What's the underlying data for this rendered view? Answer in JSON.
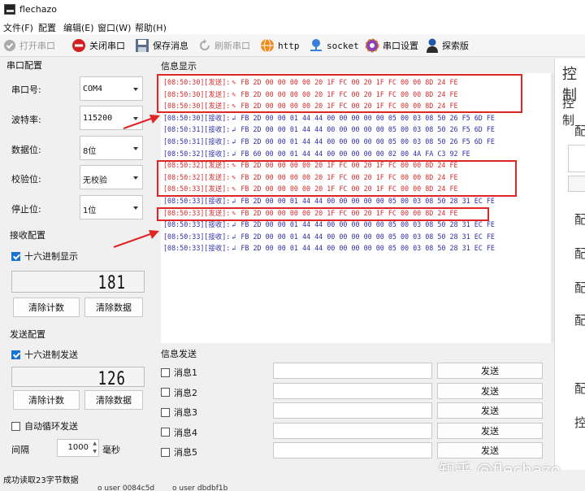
{
  "window": {
    "title": "flechazo"
  },
  "menu": [
    "文件(F)",
    "配置",
    "编辑(E)",
    "窗口(W)",
    "帮助(H)"
  ],
  "toolbar": {
    "open_port": "打开串口",
    "close_port": "关闭串口",
    "save_msg": "保存消息",
    "refresh_port": "刷新串口",
    "http": "http",
    "socket": "socket",
    "port_settings": "串口设置",
    "explore": "探索版"
  },
  "serial_config": {
    "title": "串口配置",
    "port_label": "串口号:",
    "port_value": "COM4",
    "baud_label": "波特率:",
    "baud_value": "115200",
    "data_label": "数据位:",
    "data_value": "8位",
    "parity_label": "校验位:",
    "parity_value": "无校验",
    "stop_label": "停止位:",
    "stop_value": "1位"
  },
  "receive_config": {
    "title": "接收配置",
    "hex_label": "十六进制显示",
    "count": "181",
    "clear_count": "清除计数",
    "clear_data": "清除数据"
  },
  "send_config": {
    "title": "发送配置",
    "hex_label": "十六进制发送",
    "count": "126",
    "clear_count": "清除计数",
    "clear_data": "清除数据",
    "auto_loop": "自动循环发送",
    "interval_label": "间隔",
    "interval_value": "1000",
    "interval_unit": "毫秒"
  },
  "info_display": {
    "title": "信息显示",
    "lines": [
      {
        "type": "send",
        "time": "[08:50:30]",
        "tag": "[发送]:",
        "data": "FB 2D 00 00 00 00 20 1F FC 00 20 1F FC 00 00 8D 24 FE"
      },
      {
        "type": "send",
        "time": "[08:50:30]",
        "tag": "[发送]:",
        "data": "FB 2D 00 00 00 00 20 1F FC 00 20 1F FC 00 00 8D 24 FE"
      },
      {
        "type": "send",
        "time": "[08:50:30]",
        "tag": "[发送]:",
        "data": "FB 2D 00 00 00 00 20 1F FC 00 20 1F FC 00 00 8D 24 FE"
      },
      {
        "type": "recv",
        "time": "[08:50:30]",
        "tag": "[接收]:",
        "data": "FB 2D 00 00 01 44 44 00 00 00 00 00 05 00 03 08 50 26 F5 6D FE"
      },
      {
        "type": "recv",
        "time": "[08:50:31]",
        "tag": "[接收]:",
        "data": "FB 2D 00 00 01 44 44 00 00 00 00 00 05 00 03 08 50 26 F5 6D FE"
      },
      {
        "type": "recv",
        "time": "[08:50:31]",
        "tag": "[接收]:",
        "data": "FB 2D 00 00 01 44 44 00 00 00 00 00 05 00 03 08 50 26 F5 6D FE"
      },
      {
        "type": "recv",
        "time": "[08:50:32]",
        "tag": "[接收]:",
        "data": "FB 60 00 00 01 44 44 00 00 00 00 00 02 00 4A FA C3 92 FE"
      },
      {
        "type": "send",
        "time": "[08:50:32]",
        "tag": "[发送]:",
        "data": "FB 2D 00 00 00 00 20 1F FC 00 20 1F FC 00 00 8D 24 FE"
      },
      {
        "type": "send",
        "time": "[08:50:32]",
        "tag": "[发送]:",
        "data": "FB 2D 00 00 00 00 20 1F FC 00 20 1F FC 00 00 8D 24 FE"
      },
      {
        "type": "send",
        "time": "[08:50:33]",
        "tag": "[发送]:",
        "data": "FB 2D 00 00 00 00 20 1F FC 00 20 1F FC 00 00 8D 24 FE"
      },
      {
        "type": "recv",
        "time": "[08:50:33]",
        "tag": "[接收]:",
        "data": "FB 2D 00 00 01 44 44 00 00 00 00 00 05 00 03 08 50 28 31 EC FE"
      },
      {
        "type": "send",
        "time": "[08:50:33]",
        "tag": "[发送]:",
        "data": "FB 2D 00 00 00 00 20 1F FC 00 20 1F FC 00 00 8D 24 FE"
      },
      {
        "type": "recv",
        "time": "[08:50:33]",
        "tag": "[接收]:",
        "data": "FB 2D 00 00 01 44 44 00 00 00 00 00 05 00 03 08 50 28 31 EC FE"
      },
      {
        "type": "recv",
        "time": "[08:50:33]",
        "tag": "[接收]:",
        "data": "FB 2D 00 00 01 44 44 00 00 00 00 00 05 00 03 08 50 28 31 EC FE"
      },
      {
        "type": "recv",
        "time": "[08:50:33]",
        "tag": "[接收]:",
        "data": "FB 2D 00 00 01 44 44 00 00 00 00 00 05 00 03 08 50 28 31 EC FE"
      }
    ]
  },
  "info_send": {
    "title": "信息发送",
    "send_label": "发送",
    "messages": [
      "消息1",
      "消息2",
      "消息3",
      "消息4",
      "消息5"
    ]
  },
  "right_panel": {
    "title": "控制",
    "items": [
      "控制",
      "配",
      "配",
      "配",
      "配",
      "配",
      "控"
    ]
  },
  "status": {
    "text": "成功读取23字节数据",
    "extra1": "o user 0084c5d",
    "extra2": "o user dbdbf1b"
  },
  "watermark": "知乎 @flechazo"
}
